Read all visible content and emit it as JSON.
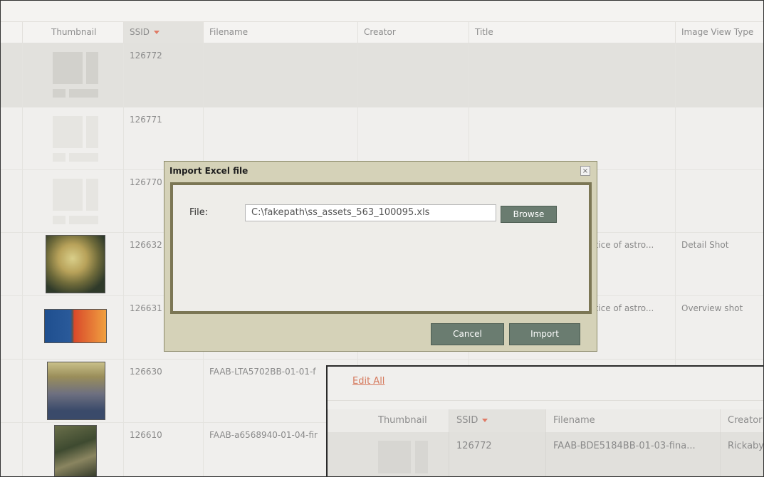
{
  "grid": {
    "columns": [
      "Thumbnail",
      "SSID",
      "Filename",
      "Creator",
      "Title",
      "Image View Type"
    ],
    "sorted_column": "SSID",
    "rows": [
      {
        "ssid": "126772",
        "filename": "",
        "creator": "",
        "title": "",
        "view_type": "",
        "thumbnail": "placeholder",
        "selected": true
      },
      {
        "ssid": "126771",
        "filename": "",
        "creator": "",
        "title": "",
        "view_type": "",
        "thumbnail": "placeholder"
      },
      {
        "ssid": "126770",
        "filename": "",
        "creator": "",
        "title": "",
        "view_type": "",
        "thumbnail": "placeholder"
      },
      {
        "ssid": "126632",
        "filename": "",
        "creator": "",
        "title": "ctice of astro...",
        "view_type": "Detail Shot",
        "thumbnail": "image"
      },
      {
        "ssid": "126631",
        "filename": "",
        "creator": "",
        "title": "ctice of astro...",
        "view_type": "Overview shot",
        "thumbnail": "image"
      },
      {
        "ssid": "126630",
        "filename": "FAAB-LTA5702BB-01-01-f",
        "creator": "",
        "title": "",
        "view_type": "",
        "thumbnail": "image"
      },
      {
        "ssid": "126610",
        "filename": "FAAB-a6568940-01-04-fir",
        "creator": "",
        "title": "",
        "view_type": "",
        "thumbnail": "image"
      }
    ]
  },
  "dialog": {
    "title": "Import Excel file",
    "close_label": "×",
    "file_label": "File:",
    "file_value": "C:\\fakepath\\ss_assets_563_100095.xls",
    "browse_label": "Browse",
    "cancel_label": "Cancel",
    "import_label": "Import"
  },
  "inset": {
    "edit_all_label": "Edit All",
    "columns": [
      "Thumbnail",
      "SSID",
      "Filename",
      "Creator"
    ],
    "row": {
      "ssid": "126772",
      "filename": "FAAB-BDE5184BB-01-03-fina...",
      "creator": "Rickaby"
    }
  },
  "colors": {
    "accent": "#e07b66",
    "button": "#6a7c70",
    "dialog_border": "#7b7654",
    "link": "#d67a5e"
  }
}
